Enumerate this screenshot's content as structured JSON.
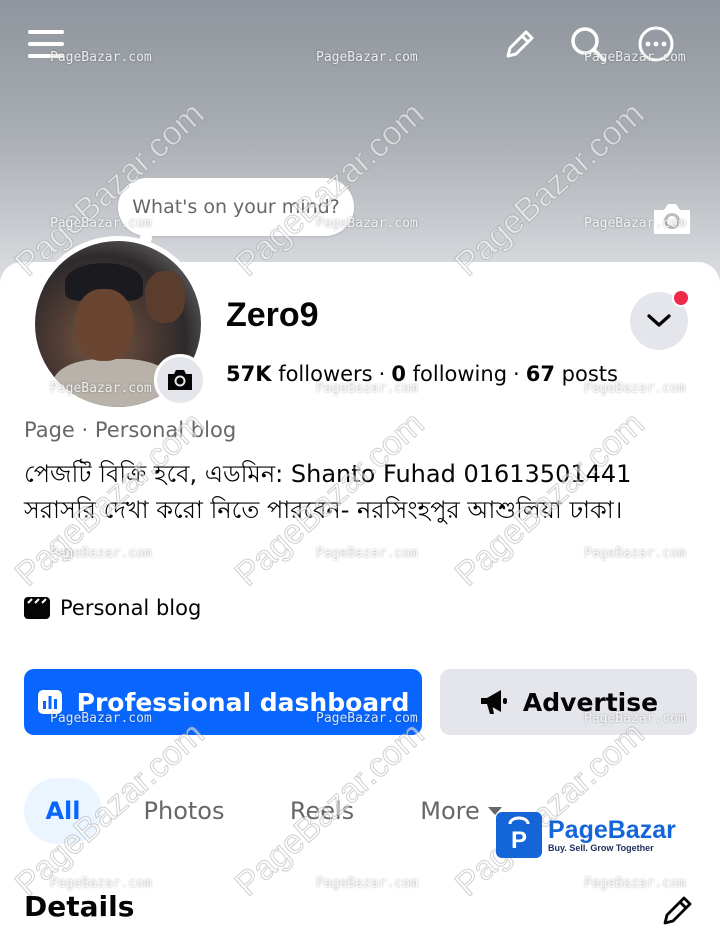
{
  "composer": {
    "placeholder": "What's on your mind?"
  },
  "profile": {
    "name": "Zero9",
    "followers_count": "57K",
    "followers_label": "followers",
    "following_count": "0",
    "following_label": "following",
    "posts_count": "67",
    "posts_label": "posts",
    "category": "Page · Personal blog",
    "bio": "পেজটি বিক্রি হবে, এডমিন: Shanto Fuhad 01613501441 সরাসরি দেখা করো নিতে পারবেন- নরসিংহপুর আশুলিয়া ঢাকা।",
    "page_type": "Personal blog"
  },
  "actions": {
    "dashboard_label": "Professional dashboard",
    "advertise_label": "Advertise"
  },
  "tabs": [
    {
      "label": "All"
    },
    {
      "label": "Photos"
    },
    {
      "label": "Reels"
    },
    {
      "label": "More"
    }
  ],
  "section": {
    "details_title": "Details"
  },
  "watermark": {
    "small": "PageBazar.com",
    "big": "PageBazar.com",
    "brand_name": "PageBazar",
    "brand_tagline": "Buy. Sell. Grow Together"
  },
  "colors": {
    "primary": "#0866ff",
    "secondary_bg": "#e4e6eb",
    "notification": "#f02849",
    "brand": "#1466d8"
  },
  "icons": [
    "menu-icon",
    "edit-icon",
    "search-icon",
    "more-icon",
    "camera-icon",
    "chevron-down-icon",
    "clapper-icon",
    "dashboard-icon",
    "megaphone-icon",
    "caret-down-icon",
    "pencil-icon"
  ]
}
